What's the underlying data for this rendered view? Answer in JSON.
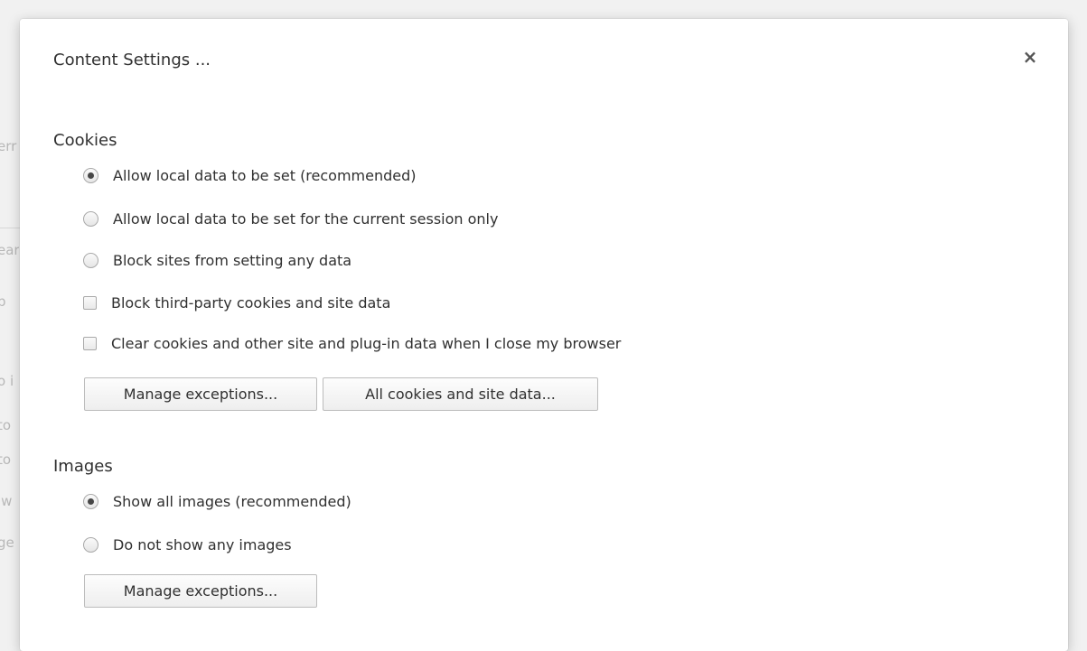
{
  "background_fragments": [
    "err",
    "ear",
    "b",
    "o i",
    "to",
    "to",
    "lw",
    "ge"
  ],
  "dialog": {
    "title": "Content Settings ...",
    "close_label": "×"
  },
  "cookies": {
    "title": "Cookies",
    "radio_options": [
      {
        "label": "Allow local data to be set (recommended)",
        "selected": true
      },
      {
        "label": "Allow local data to be set for the current session only",
        "selected": false
      },
      {
        "label": "Block sites from setting any data",
        "selected": false
      }
    ],
    "checkbox_options": [
      {
        "label": "Block third-party cookies and site data",
        "checked": false
      },
      {
        "label": "Clear cookies and other site and plug-in data when I close my browser",
        "checked": false
      }
    ],
    "buttons": {
      "manage_exceptions": "Manage exceptions...",
      "all_cookies": "All cookies and site data..."
    }
  },
  "images": {
    "title": "Images",
    "radio_options": [
      {
        "label": "Show all images (recommended)",
        "selected": true
      },
      {
        "label": "Do not show any images",
        "selected": false
      }
    ],
    "buttons": {
      "manage_exceptions": "Manage exceptions..."
    }
  }
}
